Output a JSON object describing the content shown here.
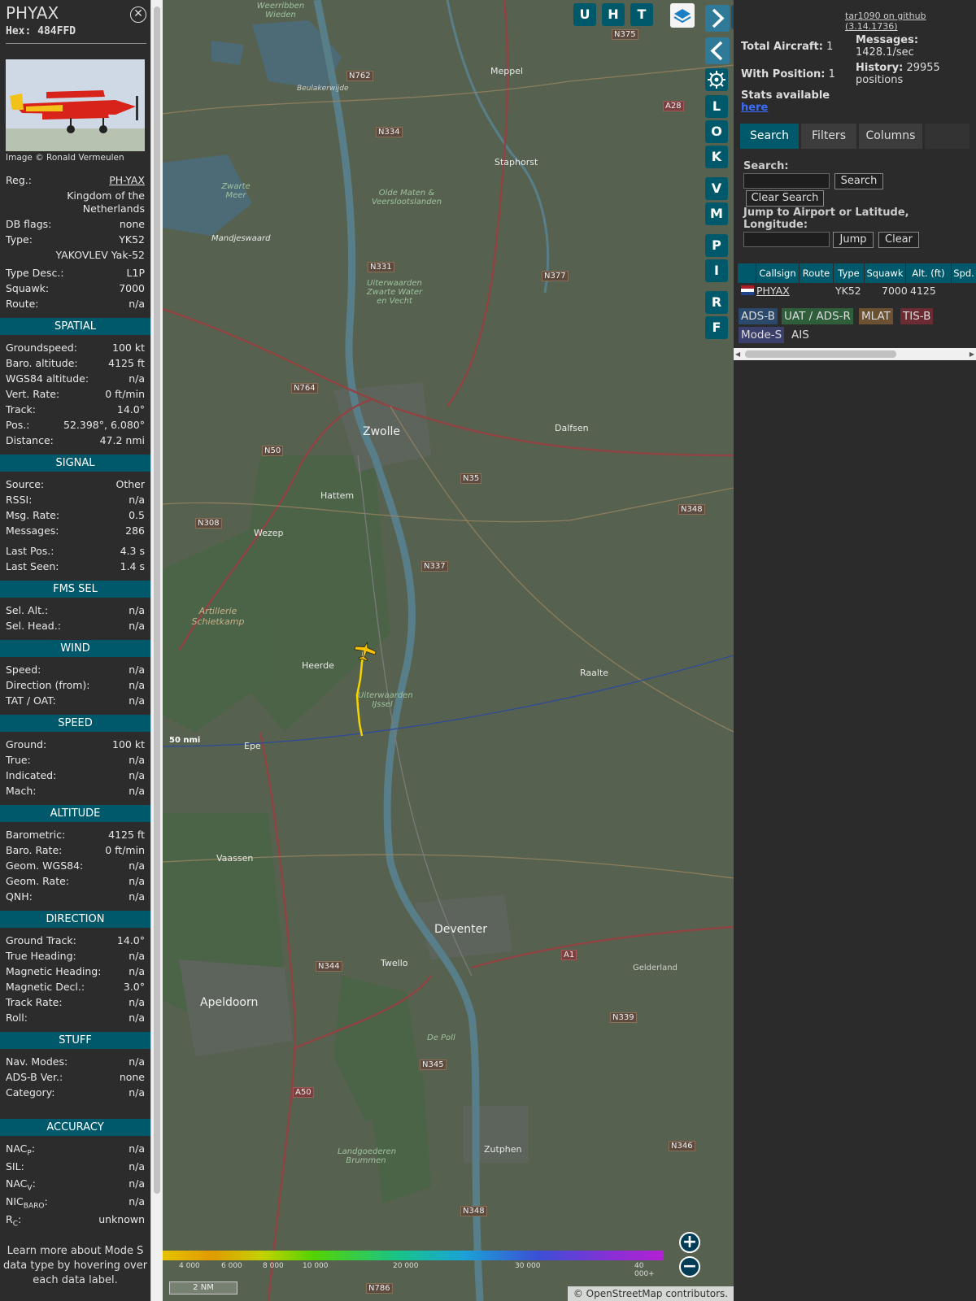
{
  "sidebar": {
    "callsign": "PHYAX",
    "hex": "Hex: 484FFD",
    "close_icon": "circle-x-icon",
    "photo_credit": "Image © Ronald Vermeulen",
    "info": [
      {
        "label": "Reg.:",
        "value": "PH-YAX"
      },
      {
        "label": "",
        "value": "Kingdom of the Netherlands"
      },
      {
        "label": "DB flags:",
        "value": "none"
      },
      {
        "label": "Type:",
        "value": "YK52"
      },
      {
        "label": "",
        "value": "YAKOVLEV Yak-52"
      },
      {
        "label": "Type Desc.:",
        "value": "L1P"
      },
      {
        "label": "Squawk:",
        "value": "7000"
      },
      {
        "label": "Route:",
        "value": "n/a"
      }
    ],
    "sections": {
      "spatial": "SPATIAL",
      "signal": "SIGNAL",
      "fms": "FMS SEL",
      "wind": "WIND",
      "speed": "SPEED",
      "altitude": "ALTITUDE",
      "direction": "DIRECTION",
      "stuff": "STUFF",
      "accuracy": "ACCURACY"
    },
    "spatial": [
      {
        "label": "Groundspeed:",
        "value": "100 kt"
      },
      {
        "label": "Baro. altitude:",
        "value": "4125 ft"
      },
      {
        "label": "WGS84 altitude:",
        "value": "n/a"
      },
      {
        "label": "Vert. Rate:",
        "value": "0 ft/min"
      },
      {
        "label": "Track:",
        "value": "14.0°"
      },
      {
        "label": "Pos.:",
        "value": "52.398°, 6.080°"
      },
      {
        "label": "Distance:",
        "value": "47.2 nmi"
      }
    ],
    "signal": [
      {
        "label": "Source:",
        "value": "Other"
      },
      {
        "label": "RSSI:",
        "value": "n/a"
      },
      {
        "label": "Msg. Rate:",
        "value": "0.5"
      },
      {
        "label": "Messages:",
        "value": "286"
      },
      {
        "label": "Last Pos.:",
        "value": "4.3 s"
      },
      {
        "label": "Last Seen:",
        "value": "1.4 s"
      }
    ],
    "fms": [
      {
        "label": "Sel. Alt.:",
        "value": "n/a"
      },
      {
        "label": "Sel. Head.:",
        "value": "n/a"
      }
    ],
    "wind": [
      {
        "label": "Speed:",
        "value": "n/a"
      },
      {
        "label": "Direction (from):",
        "value": "n/a"
      },
      {
        "label": "TAT / OAT:",
        "value": "n/a"
      }
    ],
    "speed": [
      {
        "label": "Ground:",
        "value": "100 kt"
      },
      {
        "label": "True:",
        "value": "n/a"
      },
      {
        "label": "Indicated:",
        "value": "n/a"
      },
      {
        "label": "Mach:",
        "value": "n/a"
      }
    ],
    "altitude": [
      {
        "label": "Barometric:",
        "value": "4125 ft"
      },
      {
        "label": "Baro. Rate:",
        "value": "0 ft/min"
      },
      {
        "label": "Geom. WGS84:",
        "value": "n/a"
      },
      {
        "label": "Geom. Rate:",
        "value": "n/a"
      },
      {
        "label": "QNH:",
        "value": "n/a"
      }
    ],
    "direction": [
      {
        "label": "Ground Track:",
        "value": "14.0°"
      },
      {
        "label": "True Heading:",
        "value": "n/a"
      },
      {
        "label": "Magnetic Heading:",
        "value": "n/a"
      },
      {
        "label": "Magnetic Decl.:",
        "value": "3.0°"
      },
      {
        "label": "Track Rate:",
        "value": "n/a"
      },
      {
        "label": "Roll:",
        "value": "n/a"
      }
    ],
    "stuff": [
      {
        "label": "Nav. Modes:",
        "value": "n/a"
      },
      {
        "label": "ADS-B Ver.:",
        "value": "none"
      },
      {
        "label": "Category:",
        "value": "n/a"
      }
    ],
    "accuracy": [
      {
        "label": "NAC",
        "sub": "P",
        "value": "n/a"
      },
      {
        "label": "SIL:",
        "sub": "",
        "value": "n/a"
      },
      {
        "label": "NAC",
        "sub": "V",
        "value": "n/a"
      },
      {
        "label": "NIC",
        "sub": "BARO",
        "value": "n/a"
      },
      {
        "label": "R",
        "sub": "C",
        "value": "unknown"
      }
    ],
    "footer": "Learn more about Mode S data type by hovering over each data label."
  },
  "map": {
    "places": [
      "Meppel",
      "Staphorst",
      "Zwolle",
      "Dalfsen",
      "Hattem",
      "Wezep",
      "Heerde",
      "Raalte",
      "Epe",
      "Vaassen",
      "Deventer",
      "Twello",
      "Apeldoorn",
      "Zutphen",
      "Mandjeswaard",
      "Artillerie Schietkamp",
      "Zwarte Meer",
      "Olde Maten & Veerslootslanden",
      "Uiterwaarden Zwarte Water en Vecht",
      "Uiterwaarden IJssel",
      "De Poll",
      "Landgoederen Brummen",
      "Gelderland",
      "Beulakerwijde",
      "Weerribben Wieden"
    ],
    "roads": [
      "N375",
      "N762",
      "N334",
      "A28",
      "N331",
      "N377",
      "N764",
      "N50",
      "N35",
      "N348",
      "N308",
      "N337",
      "N344",
      "A1",
      "N339",
      "N345",
      "A50",
      "N346",
      "N348",
      "N786"
    ],
    "range_ring_label": "50 nmi",
    "scale_label": "2 NM",
    "altitude_ticks": [
      "4 000",
      "6 000",
      "8 000",
      "10 000",
      "20 000",
      "30 000",
      "40 000+"
    ],
    "attribution": "© OpenStreetMap contributors.",
    "buttons": {
      "u": "U",
      "h": "H",
      "t": "T",
      "l": "L",
      "o": "O",
      "k": "K",
      "v": "V",
      "m": "M",
      "p": "P",
      "i": "I",
      "r": "R",
      "f": "F"
    },
    "layers_icon": "layers-icon",
    "settings_icon": "gear-icon",
    "zoom_in_icon": "plus-icon",
    "zoom_out_icon": "minus-icon"
  },
  "panel": {
    "github_link": "tar1090 on github (3.14.1736)",
    "total_aircraft_label": "Total Aircraft:",
    "total_aircraft": "1",
    "with_position_label": "With Position:",
    "with_position": "1",
    "messages_label": "Messages:",
    "messages_value": "1428.1/sec",
    "history_label": "History:",
    "history_value": "29955 positions",
    "stats_label": "Stats available",
    "stats_link": "here",
    "tabs": [
      "Search",
      "Filters",
      "Columns"
    ],
    "search_label": "Search:",
    "search_button": "Search",
    "clear_search_button": "Clear Search",
    "jump_label": "Jump to Airport or Latitude, Longitude:",
    "jump_button": "Jump",
    "clear_button": "Clear",
    "columns": [
      "Callsign",
      "Route",
      "Type",
      "Squawk",
      "Alt. (ft)",
      "Spd."
    ],
    "row": {
      "callsign": "PHYAX",
      "route": "",
      "type": "YK52",
      "squawk": "7000",
      "alt": "4125"
    },
    "badges": [
      "ADS-B",
      "UAT / ADS-R",
      "MLAT",
      "TIS-B",
      "Mode-S",
      "AIS"
    ]
  }
}
